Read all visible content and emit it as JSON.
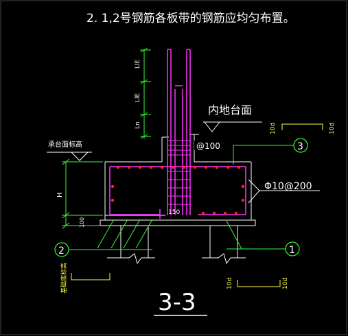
{
  "title": "2. 1,2号钢筋各板带的钢筋应均匀布置。",
  "labels": {
    "interior_ground": "内地台面",
    "cap_top_elevation": "承台面标高",
    "stirrup_spacing": "@100",
    "hoop_rebar": "Φ10@200",
    "lie_upper": "LlE",
    "lie_lower": "LlE",
    "ln": "Ln",
    "height": "H",
    "base_dim": "100",
    "dim_150": "150",
    "dim_10d_top_left": "10d",
    "dim_10d_top_right": "10d",
    "dim_10d_bottom_left": "10d",
    "dim_10d_bottom_right": "10d",
    "foundation_elevation": "基础底标高",
    "section": "3-3"
  },
  "callouts": {
    "bar_1": "1",
    "bar_2": "2",
    "bar_3": "3"
  },
  "colors": {
    "background": "#000000",
    "title": "#ffffff",
    "concrete_outline": "#ffffff",
    "rebar": "#ff33ff",
    "rebar_dots": "#ff2222",
    "dimension": "#00ff00",
    "labels_yellow": "#ffff44",
    "callout_green": "#33ff33"
  }
}
